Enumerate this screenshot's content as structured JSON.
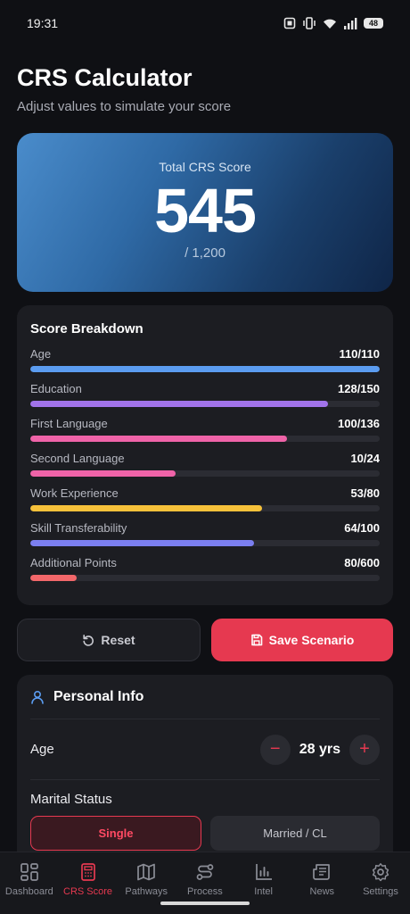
{
  "status": {
    "time": "19:31",
    "battery": "48"
  },
  "header": {
    "title": "CRS Calculator",
    "subtitle": "Adjust values to simulate your score"
  },
  "score": {
    "label": "Total CRS Score",
    "value": "545",
    "max": "/ 1,200"
  },
  "breakdown": {
    "title": "Score Breakdown",
    "items": [
      {
        "label": "Age",
        "value": "110/110",
        "fraction": 1.0,
        "color": "#5b9cf0"
      },
      {
        "label": "Education",
        "value": "128/150",
        "fraction": 0.853,
        "color": "#a173ea"
      },
      {
        "label": "First Language",
        "value": "100/136",
        "fraction": 0.735,
        "color": "#ef63a8"
      },
      {
        "label": "Second Language",
        "value": "10/24",
        "fraction": 0.417,
        "color": "#ef63a8"
      },
      {
        "label": "Work Experience",
        "value": "53/80",
        "fraction": 0.663,
        "color": "#f6c13a"
      },
      {
        "label": "Skill Transferability",
        "value": "64/100",
        "fraction": 0.64,
        "color": "#7b7ff0"
      },
      {
        "label": "Additional Points",
        "value": "80/600",
        "fraction": 0.133,
        "color": "#f2676a"
      }
    ]
  },
  "actions": {
    "reset": "Reset",
    "save": "Save Scenario"
  },
  "personal": {
    "title": "Personal Info",
    "age_label": "Age",
    "age_value": "28 yrs",
    "marital_label": "Marital Status",
    "marital_options": [
      "Single",
      "Married / CL"
    ],
    "marital_selected": "Single"
  },
  "nav": {
    "items": [
      {
        "label": "Dashboard",
        "icon": "dashboard-icon"
      },
      {
        "label": "CRS Score",
        "icon": "calculator-icon"
      },
      {
        "label": "Pathways",
        "icon": "map-icon"
      },
      {
        "label": "Process",
        "icon": "route-icon"
      },
      {
        "label": "Intel",
        "icon": "bar-chart-icon"
      },
      {
        "label": "News",
        "icon": "newspaper-icon"
      },
      {
        "label": "Settings",
        "icon": "gear-icon"
      }
    ],
    "active": "CRS Score"
  },
  "colors": {
    "accent": "#e63950",
    "background": "#0f1014",
    "card": "#1c1d22"
  }
}
